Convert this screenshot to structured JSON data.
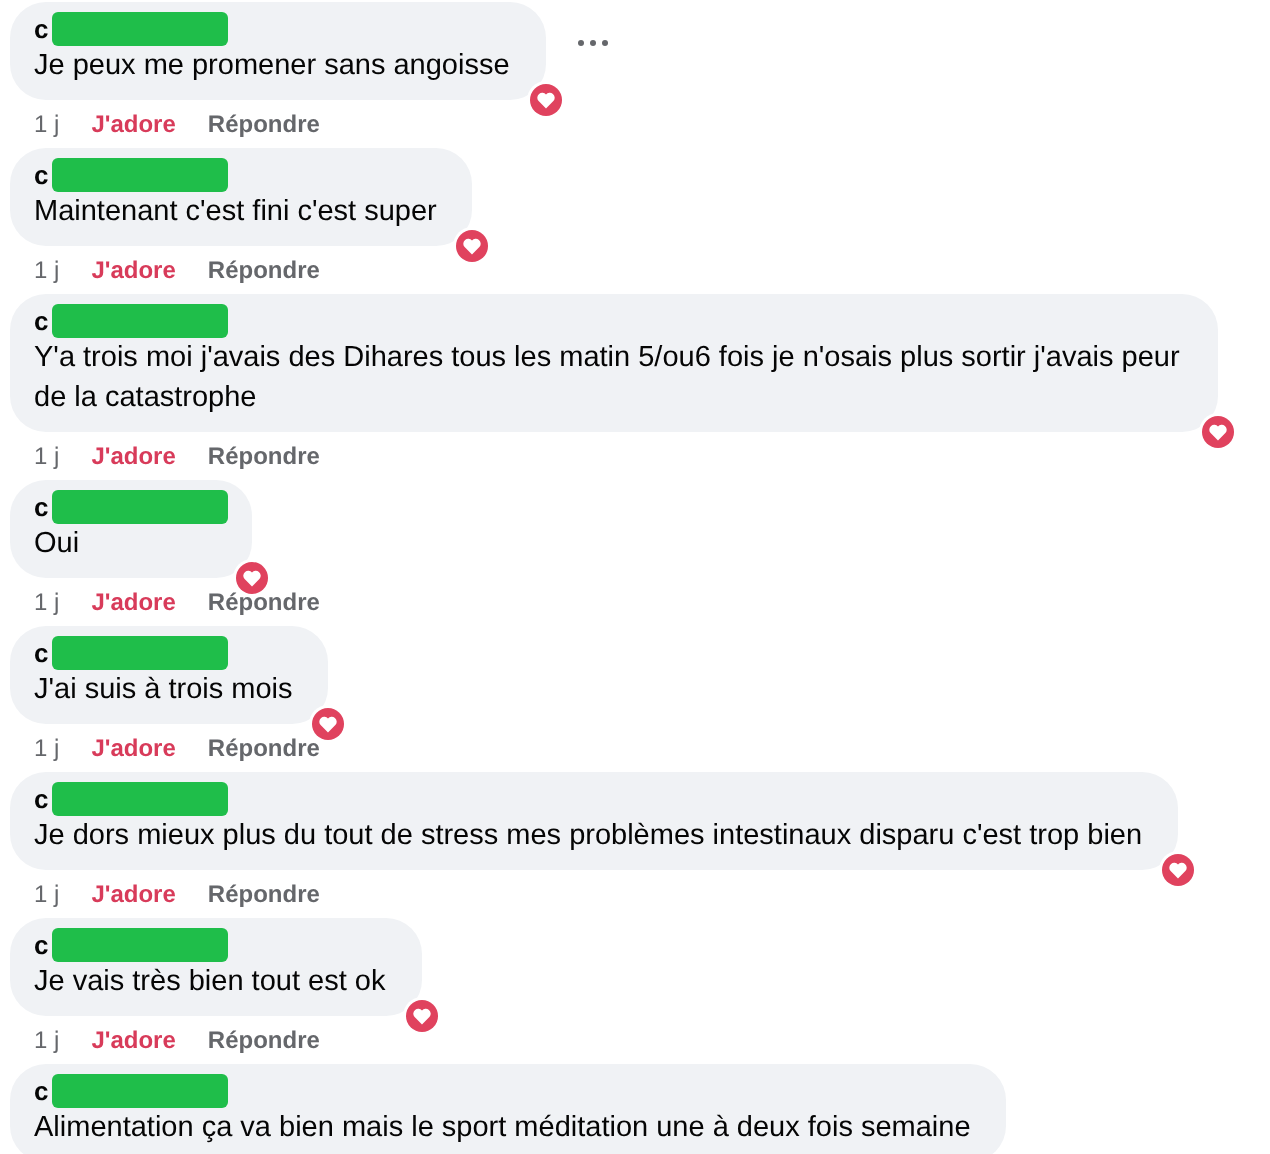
{
  "comments": [
    {
      "author": "c",
      "text": "Je peux me promener sans angoisse",
      "time": "1 j",
      "like_label": "J'adore",
      "liked": true,
      "reply_label": "Répondre",
      "heart_reaction": true,
      "menu_visible": true
    },
    {
      "author": "c",
      "text": "Maintenant c'est fini c'est super",
      "time": "1 j",
      "like_label": "J'adore",
      "liked": true,
      "reply_label": "Répondre",
      "heart_reaction": true
    },
    {
      "author": "c",
      "text": "Y'a trois moi j'avais des Dihares tous les matin 5/ou6 fois je n'osais plus sortir j'avais peur de la catastrophe",
      "time": "1 j",
      "like_label": "J'adore",
      "liked": true,
      "reply_label": "Répondre",
      "heart_reaction": true
    },
    {
      "author": "c",
      "text": "Oui",
      "time": "1 j",
      "like_label": "J'adore",
      "liked": true,
      "reply_label": "Répondre",
      "heart_reaction": true
    },
    {
      "author": "c",
      "text": "J'ai suis à trois mois",
      "time": "1 j",
      "like_label": "J'adore",
      "liked": true,
      "reply_label": "Répondre",
      "heart_reaction": true
    },
    {
      "author": "c",
      "text": "Je dors mieux plus du tout de stress mes problèmes intestinaux disparu c'est trop bien",
      "time": "1 j",
      "like_label": "J'adore",
      "liked": true,
      "reply_label": "Répondre",
      "heart_reaction": true
    },
    {
      "author": "c",
      "text": "Je vais très bien tout est ok",
      "time": "1 j",
      "like_label": "J'adore",
      "liked": true,
      "reply_label": "Répondre",
      "heart_reaction": true
    },
    {
      "author": "c",
      "text": "Alimentation ça va bien mais le sport méditation une à deux fois semaine"
    }
  ]
}
